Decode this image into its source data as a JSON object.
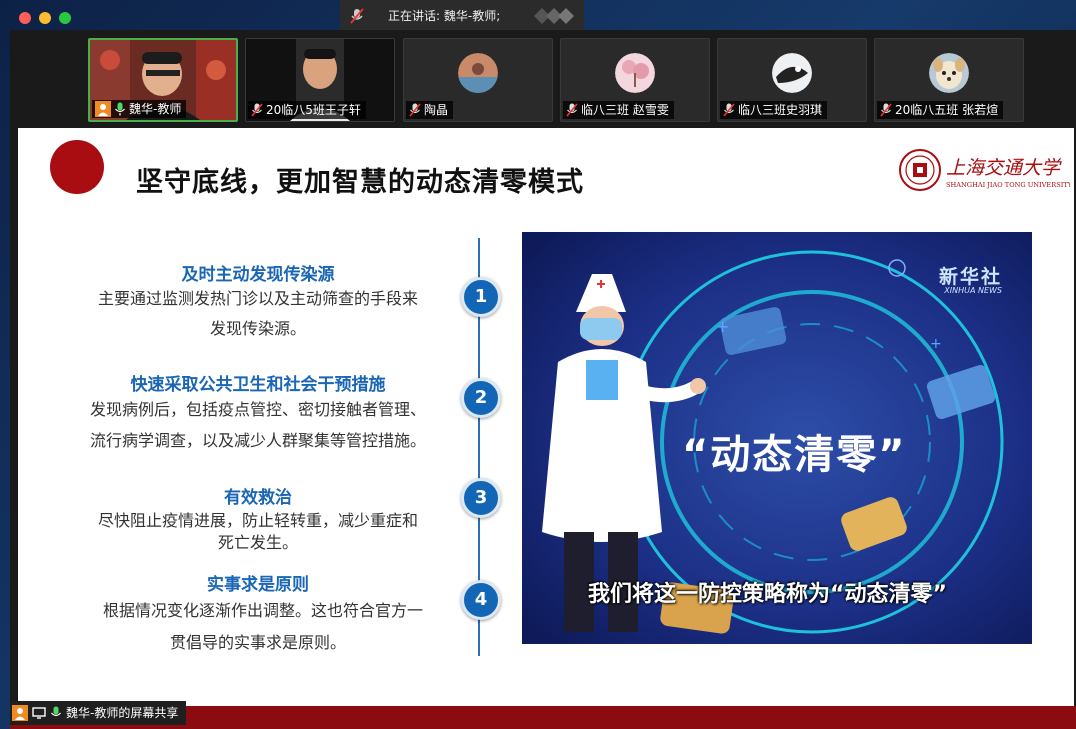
{
  "window": {
    "speaker_label": "正在讲话: 魏华-教师;"
  },
  "participants": [
    {
      "name": "魏华-教师",
      "active": true,
      "video": true
    },
    {
      "name": "20临八5班王子轩",
      "video": true
    },
    {
      "name": "陶晶",
      "avatar_color": "#c98a6a"
    },
    {
      "name": "临八三班 赵雪雯",
      "avatar_color": "#e9a7b6"
    },
    {
      "name": "临八三班史羽琪",
      "avatar_color": "#dde4ea"
    },
    {
      "name": "20临八五班 张若煊",
      "avatar_color": "#d8c9a8"
    }
  ],
  "slide": {
    "title": "坚守底线，更加智慧的动态清零模式",
    "logo_text_cn": "上海交通大学",
    "logo_text_en": "SHANGHAI JIAO TONG UNIVERSITY",
    "items": [
      {
        "num": "1",
        "head": "及时主动发现传染源",
        "body1": "主要通过监测发热门诊以及主动筛查的手段来",
        "body2": "发现传染源。"
      },
      {
        "num": "2",
        "head": "快速采取公共卫生和社会干预措施",
        "body1": "发现病例后，包括疫点管控、密切接触者管理、",
        "body2": "流行病学调查，以及减少人群聚集等管控措施。"
      },
      {
        "num": "3",
        "head": "有效救治",
        "body1": "尽快阻止疫情进展，防止轻转重，减少重症和",
        "body2": "死亡发生。"
      },
      {
        "num": "4",
        "head": "实事求是原则",
        "body1": "根据情况变化逐渐作出调整。这也符合官方一",
        "body2": "贯倡导的实事求是原则。"
      }
    ],
    "video": {
      "brand_cn": "新华社",
      "brand_en": "XINHUA NEWS",
      "big_title": "“动态清零”",
      "subtitle": "我们将这一防控策略称为“动态清零”"
    }
  },
  "share_label": "魏华-教师的屏幕共享",
  "colors": {
    "accent_blue": "#1366b6",
    "dark_red": "#a90d12",
    "active_border": "#48b04a"
  }
}
